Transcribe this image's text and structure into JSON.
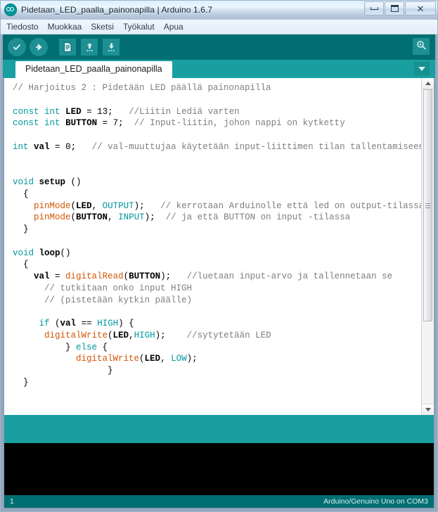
{
  "window": {
    "title": "Pidetaan_LED_paalla_painonapilla | Arduino 1.6.7",
    "app_icon": "arduino-infinity-icon",
    "controls": {
      "minimize": "minimize-icon",
      "maximize": "maximize-icon",
      "close": "✕"
    }
  },
  "menubar": {
    "items": [
      {
        "label": "Tiedosto"
      },
      {
        "label": "Muokkaa"
      },
      {
        "label": "Sketsi"
      },
      {
        "label": "Työkalut"
      },
      {
        "label": "Apua"
      }
    ]
  },
  "toolbar": {
    "verify": {
      "name": "verify-button",
      "icon": "checkmark-icon"
    },
    "upload": {
      "name": "upload-button",
      "icon": "arrow-right-icon"
    },
    "new": {
      "name": "new-sketch-button",
      "icon": "document-icon"
    },
    "open": {
      "name": "open-sketch-button",
      "icon": "arrow-up-icon"
    },
    "save": {
      "name": "save-sketch-button",
      "icon": "arrow-down-icon"
    },
    "serial_monitor": {
      "name": "serial-monitor-button",
      "icon": "magnifier-icon"
    }
  },
  "tabs": {
    "active_tab": "Pidetaan_LED_paalla_painonapilla",
    "menu_icon": "chevron-down-icon"
  },
  "editor": {
    "lines": [
      [
        {
          "t": "// Harjoitus 2 : Pidetään LED päällä painonapilla",
          "c": "cmt"
        }
      ],
      [],
      [
        {
          "t": "const",
          "c": "kw"
        },
        {
          "t": " ",
          "c": ""
        },
        {
          "t": "int",
          "c": "kw"
        },
        {
          "t": " ",
          "c": ""
        },
        {
          "t": "LED",
          "c": "id"
        },
        {
          "t": " = ",
          "c": ""
        },
        {
          "t": "13",
          "c": "num"
        },
        {
          "t": ";",
          "c": ""
        },
        {
          "t": "   ",
          "c": ""
        },
        {
          "t": "//Liitin Lediä varten",
          "c": "cmt"
        }
      ],
      [
        {
          "t": "const",
          "c": "kw"
        },
        {
          "t": " ",
          "c": ""
        },
        {
          "t": "int",
          "c": "kw"
        },
        {
          "t": " ",
          "c": ""
        },
        {
          "t": "BUTTON",
          "c": "id"
        },
        {
          "t": " = ",
          "c": ""
        },
        {
          "t": "7",
          "c": "num"
        },
        {
          "t": ";",
          "c": ""
        },
        {
          "t": "  ",
          "c": ""
        },
        {
          "t": "// Input-liitin, johon nappi on kytketty",
          "c": "cmt"
        }
      ],
      [],
      [
        {
          "t": "int",
          "c": "kw"
        },
        {
          "t": " ",
          "c": ""
        },
        {
          "t": "val",
          "c": "id"
        },
        {
          "t": " = ",
          "c": ""
        },
        {
          "t": "0",
          "c": "num"
        },
        {
          "t": ";",
          "c": ""
        },
        {
          "t": "   ",
          "c": ""
        },
        {
          "t": "// val-muuttujaa käytetään input-liittimen tilan tallentamiseen",
          "c": "cmt"
        }
      ],
      [],
      [],
      [
        {
          "t": "void",
          "c": "kw"
        },
        {
          "t": " ",
          "c": ""
        },
        {
          "t": "setup",
          "c": "id"
        },
        {
          "t": " ()",
          "c": ""
        }
      ],
      [
        {
          "t": "  {",
          "c": ""
        }
      ],
      [
        {
          "t": "    ",
          "c": ""
        },
        {
          "t": "pinMode",
          "c": "fn"
        },
        {
          "t": "(",
          "c": ""
        },
        {
          "t": "LED",
          "c": "id"
        },
        {
          "t": ", ",
          "c": ""
        },
        {
          "t": "OUTPUT",
          "c": "lit"
        },
        {
          "t": ");",
          "c": ""
        },
        {
          "t": "   ",
          "c": ""
        },
        {
          "t": "// kerrotaan Arduinolle että led on output-tilassa",
          "c": "cmt"
        }
      ],
      [
        {
          "t": "    ",
          "c": ""
        },
        {
          "t": "pinMode",
          "c": "fn"
        },
        {
          "t": "(",
          "c": ""
        },
        {
          "t": "BUTTON",
          "c": "id"
        },
        {
          "t": ", ",
          "c": ""
        },
        {
          "t": "INPUT",
          "c": "lit"
        },
        {
          "t": ");",
          "c": ""
        },
        {
          "t": "  ",
          "c": ""
        },
        {
          "t": "// ja että BUTTON on input -tilassa",
          "c": "cmt"
        }
      ],
      [
        {
          "t": "  }",
          "c": ""
        }
      ],
      [],
      [
        {
          "t": "void",
          "c": "kw"
        },
        {
          "t": " ",
          "c": ""
        },
        {
          "t": "loop",
          "c": "id"
        },
        {
          "t": "()",
          "c": ""
        }
      ],
      [
        {
          "t": "  {",
          "c": ""
        }
      ],
      [
        {
          "t": "    ",
          "c": ""
        },
        {
          "t": "val",
          "c": "id"
        },
        {
          "t": " = ",
          "c": ""
        },
        {
          "t": "digitalRead",
          "c": "fn"
        },
        {
          "t": "(",
          "c": ""
        },
        {
          "t": "BUTTON",
          "c": "id"
        },
        {
          "t": ");",
          "c": ""
        },
        {
          "t": "   ",
          "c": ""
        },
        {
          "t": "//luetaan input-arvo ja tallennetaan se",
          "c": "cmt"
        }
      ],
      [
        {
          "t": "      ",
          "c": ""
        },
        {
          "t": "// tutkitaan onko input HIGH",
          "c": "cmt"
        }
      ],
      [
        {
          "t": "      ",
          "c": ""
        },
        {
          "t": "// (pistetään kytkin päälle)",
          "c": "cmt"
        }
      ],
      [],
      [
        {
          "t": "     ",
          "c": ""
        },
        {
          "t": "if",
          "c": "kw"
        },
        {
          "t": " (",
          "c": ""
        },
        {
          "t": "val",
          "c": "id"
        },
        {
          "t": " == ",
          "c": ""
        },
        {
          "t": "HIGH",
          "c": "lit"
        },
        {
          "t": ") {",
          "c": ""
        }
      ],
      [
        {
          "t": "      ",
          "c": ""
        },
        {
          "t": "digitalWrite",
          "c": "fn"
        },
        {
          "t": "(",
          "c": ""
        },
        {
          "t": "LED",
          "c": "id"
        },
        {
          "t": ",",
          "c": ""
        },
        {
          "t": "HIGH",
          "c": "lit"
        },
        {
          "t": ");",
          "c": ""
        },
        {
          "t": "    ",
          "c": ""
        },
        {
          "t": "//sytytetään LED",
          "c": "cmt"
        }
      ],
      [
        {
          "t": "          } ",
          "c": ""
        },
        {
          "t": "else",
          "c": "kw"
        },
        {
          "t": " {",
          "c": ""
        }
      ],
      [
        {
          "t": "            ",
          "c": ""
        },
        {
          "t": "digitalWrite",
          "c": "fn"
        },
        {
          "t": "(",
          "c": ""
        },
        {
          "t": "LED",
          "c": "id"
        },
        {
          "t": ", ",
          "c": ""
        },
        {
          "t": "LOW",
          "c": "lit"
        },
        {
          "t": ");",
          "c": ""
        }
      ],
      [
        {
          "t": "                  }",
          "c": ""
        }
      ],
      [
        {
          "t": "  }",
          "c": ""
        }
      ]
    ],
    "scrollbar": {
      "up_arrow": "scroll-up-icon",
      "down_arrow": "scroll-down-icon"
    }
  },
  "console": {
    "text": ""
  },
  "statusbar": {
    "line_number": "1",
    "board_info": "Arduino/Genuino Uno on COM3"
  },
  "colors": {
    "teal_light": "#1a9fa0",
    "teal_dark": "#006e72",
    "keyword": "#00979c",
    "function": "#d35400",
    "comment": "#7e7e7e",
    "console_bg": "#000000"
  }
}
